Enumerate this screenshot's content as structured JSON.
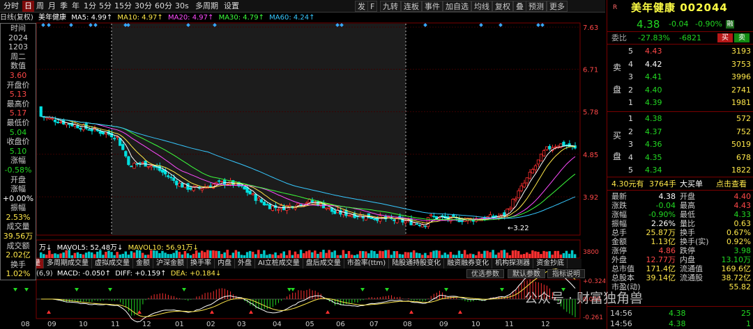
{
  "top": {
    "left_buttons": [
      "分时",
      "日",
      "周",
      "月",
      "季",
      "年",
      "1分",
      "5分",
      "15分",
      "30分",
      "60分",
      "30s",
      "多周期",
      "设置"
    ],
    "selected": "日",
    "right_buttons": [
      "发",
      "F",
      "九转",
      "连板",
      "事件",
      "加自选",
      "均线",
      "复权",
      "叠",
      "预测",
      "更多"
    ]
  },
  "ma": {
    "label": "日线(复权)",
    "name": "美年健康",
    "ma5": "MA5: 4.99↑",
    "ma10": "MA10: 4.97↑",
    "ma20": "MA20: 4.97↑",
    "ma30": "MA30: 4.79↑",
    "ma60": "MA60: 4.24↑",
    "c5": "#ffffff",
    "c10": "#ffe84a",
    "c20": "#ff4cff",
    "c30": "#3cff3c",
    "c60": "#36c8ff"
  },
  "info": [
    "时间",
    "2024",
    "1203",
    "周二",
    "数值",
    "3.60",
    "开盘价",
    "5.13",
    "最高价",
    "5.17",
    "最低价",
    "5.04",
    "收盘价",
    "5.10",
    "涨幅",
    "-0.58%",
    "开盘",
    "涨幅",
    "+0.00%",
    "振幅",
    "2.53%",
    "成交量",
    "39.56万",
    "成交额",
    "2.02亿",
    "换手",
    "1.02%"
  ],
  "axis": {
    "price": [
      "7.63",
      "6.71",
      "5.78",
      "4.85",
      "3.92"
    ],
    "low": "3.22",
    "vol": "3800",
    "macd_top": "+0.324",
    "macd_zero": "0.000",
    "macd_bot": "-0.261"
  },
  "volbar": {
    "a": "万↓",
    "b": "MAVOL5: 52.48万↓",
    "c": "MAVOL10: 56.91万↓"
  },
  "tabs": [
    "量",
    "多周期成交量",
    "虚拟成交量",
    "金额",
    "沪深金额",
    "换手率",
    "内盘",
    "外盘",
    "AI立桩成交量",
    "盘后成交量",
    "市盈率(ttm)",
    "陆股通持股变化",
    "融资融券变化",
    "机构探测器",
    "资金抄底"
  ],
  "macd": {
    "a": "(6,9)",
    "b": "MACD: -0.050↑",
    "c": "DIFF: +0.159↑",
    "d": "DEA: +0.184↓",
    "btn1": "优选参数",
    "btn2": "默认参数",
    "btn3": "指标说明"
  },
  "xlabels": [
    "08",
    "09",
    "10",
    "11",
    "12",
    "01",
    "02",
    "03",
    "04",
    "05",
    "06",
    "07",
    "08",
    "09",
    "10",
    "11",
    "12"
  ],
  "panel": {
    "name": "美年健康",
    "code": "002044",
    "price": "4.38",
    "chg": "-0.04",
    "pct": "-0.90%",
    "tag": "融",
    "wb_label": "委比",
    "wb": "-27.83%",
    "wc": "-6821",
    "buy": "买",
    "sell": "卖",
    "sells": [
      [
        "5",
        "4.43",
        "3193"
      ],
      [
        "4",
        "4.42",
        "3753"
      ],
      [
        "3",
        "4.41",
        "3996"
      ],
      [
        "2",
        "4.40",
        "2741"
      ],
      [
        "1",
        "4.39",
        "1981"
      ]
    ],
    "buys": [
      [
        "1",
        "4.38",
        "572"
      ],
      [
        "2",
        "4.37",
        "752"
      ],
      [
        "3",
        "4.36",
        "5019"
      ],
      [
        "4",
        "4.35",
        "678"
      ],
      [
        "5",
        "4.34",
        "1822"
      ]
    ],
    "sell_lbl": [
      "卖",
      "盘"
    ],
    "buy_lbl": [
      "买",
      "盘"
    ],
    "bigbuy": "4.30元有",
    "bigqty": "3764手",
    "bigname": "大买单",
    "bigview": "点击查看",
    "stats": [
      [
        "最新",
        "4.38",
        "开盘",
        "4.40"
      ],
      [
        "涨跌",
        "-0.04",
        "最高",
        "4.43"
      ],
      [
        "涨幅",
        "-0.90%",
        "最低",
        "4.33"
      ],
      [
        "振幅",
        "2.26%",
        "量比",
        "0.63"
      ],
      [
        "总手",
        "25.87万",
        "换手",
        "0.67%"
      ],
      [
        "金额",
        "1.13亿",
        "换手(实)",
        "0.92%"
      ],
      [
        "涨停",
        "4.86",
        "跌停",
        "3.98"
      ],
      [
        "外盘",
        "12.77万",
        "内盘",
        "13.10万"
      ],
      [
        "总市值",
        "171.4亿",
        "流通值",
        "169.6亿"
      ],
      [
        "总股本",
        "39.14亿",
        "流通股",
        "38.72亿"
      ],
      [
        "市盈(动)",
        "",
        "",
        "55.82"
      ]
    ],
    "ticks": [
      [
        "14:56",
        "4.38",
        "25"
      ],
      [
        "14:56",
        "4.38",
        "1"
      ]
    ]
  },
  "watermark": "公众号 · 财富独角兽"
}
